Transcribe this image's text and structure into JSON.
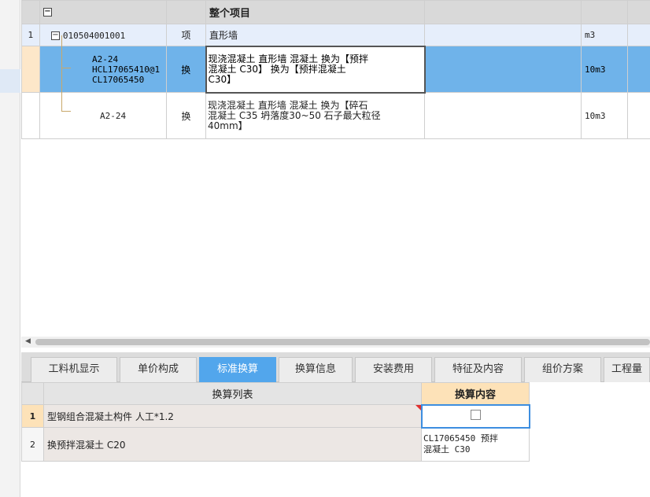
{
  "top_grid": {
    "header": {
      "tree_toggle": "−",
      "title": "整个项目"
    },
    "rows": [
      {
        "num": "1",
        "toggle": "−",
        "code": "010504001001",
        "type": "项",
        "desc": "直形墙",
        "unit": "m3"
      },
      {
        "num": "",
        "code_lines": [
          "A2-24",
          "HCL17065410@1",
          "CL17065450"
        ],
        "type": "换",
        "desc_lines": [
          "现浇混凝土 直形墙 混凝土  换为【预拌",
          "混凝土 C30】   换为【预拌混凝土",
          "C30】"
        ],
        "unit": "10m3"
      },
      {
        "num": "",
        "code": "A2-24",
        "type": "换",
        "desc_lines": [
          "现浇混凝土 直形墙 混凝土  换为【碎石",
          "混凝土 C35 坍落度30~50 石子最大粒径",
          "40mm】"
        ],
        "unit": "10m3"
      }
    ]
  },
  "tabs": [
    {
      "label": "工料机显示",
      "active": false
    },
    {
      "label": "单价构成",
      "active": false
    },
    {
      "label": "标准换算",
      "active": true
    },
    {
      "label": "换算信息",
      "active": false
    },
    {
      "label": "安装费用",
      "active": false
    },
    {
      "label": "特征及内容",
      "active": false
    },
    {
      "label": "组价方案",
      "active": false
    },
    {
      "label": "工程量",
      "active": false
    }
  ],
  "bottom_grid": {
    "col_list": "换算列表",
    "col_content": "换算内容",
    "rows": [
      {
        "num": "1",
        "item": "型钢组合混凝土构件 人工*1.2",
        "content": ""
      },
      {
        "num": "2",
        "item": "换预拌混凝土 C20",
        "content_lines": [
          "CL17065450  预拌",
          "混凝土 C30"
        ]
      }
    ]
  },
  "colors": {
    "selected_row": "#6fb3ea",
    "active_tab": "#52a6ec",
    "highlight_header": "#fde2b8"
  }
}
